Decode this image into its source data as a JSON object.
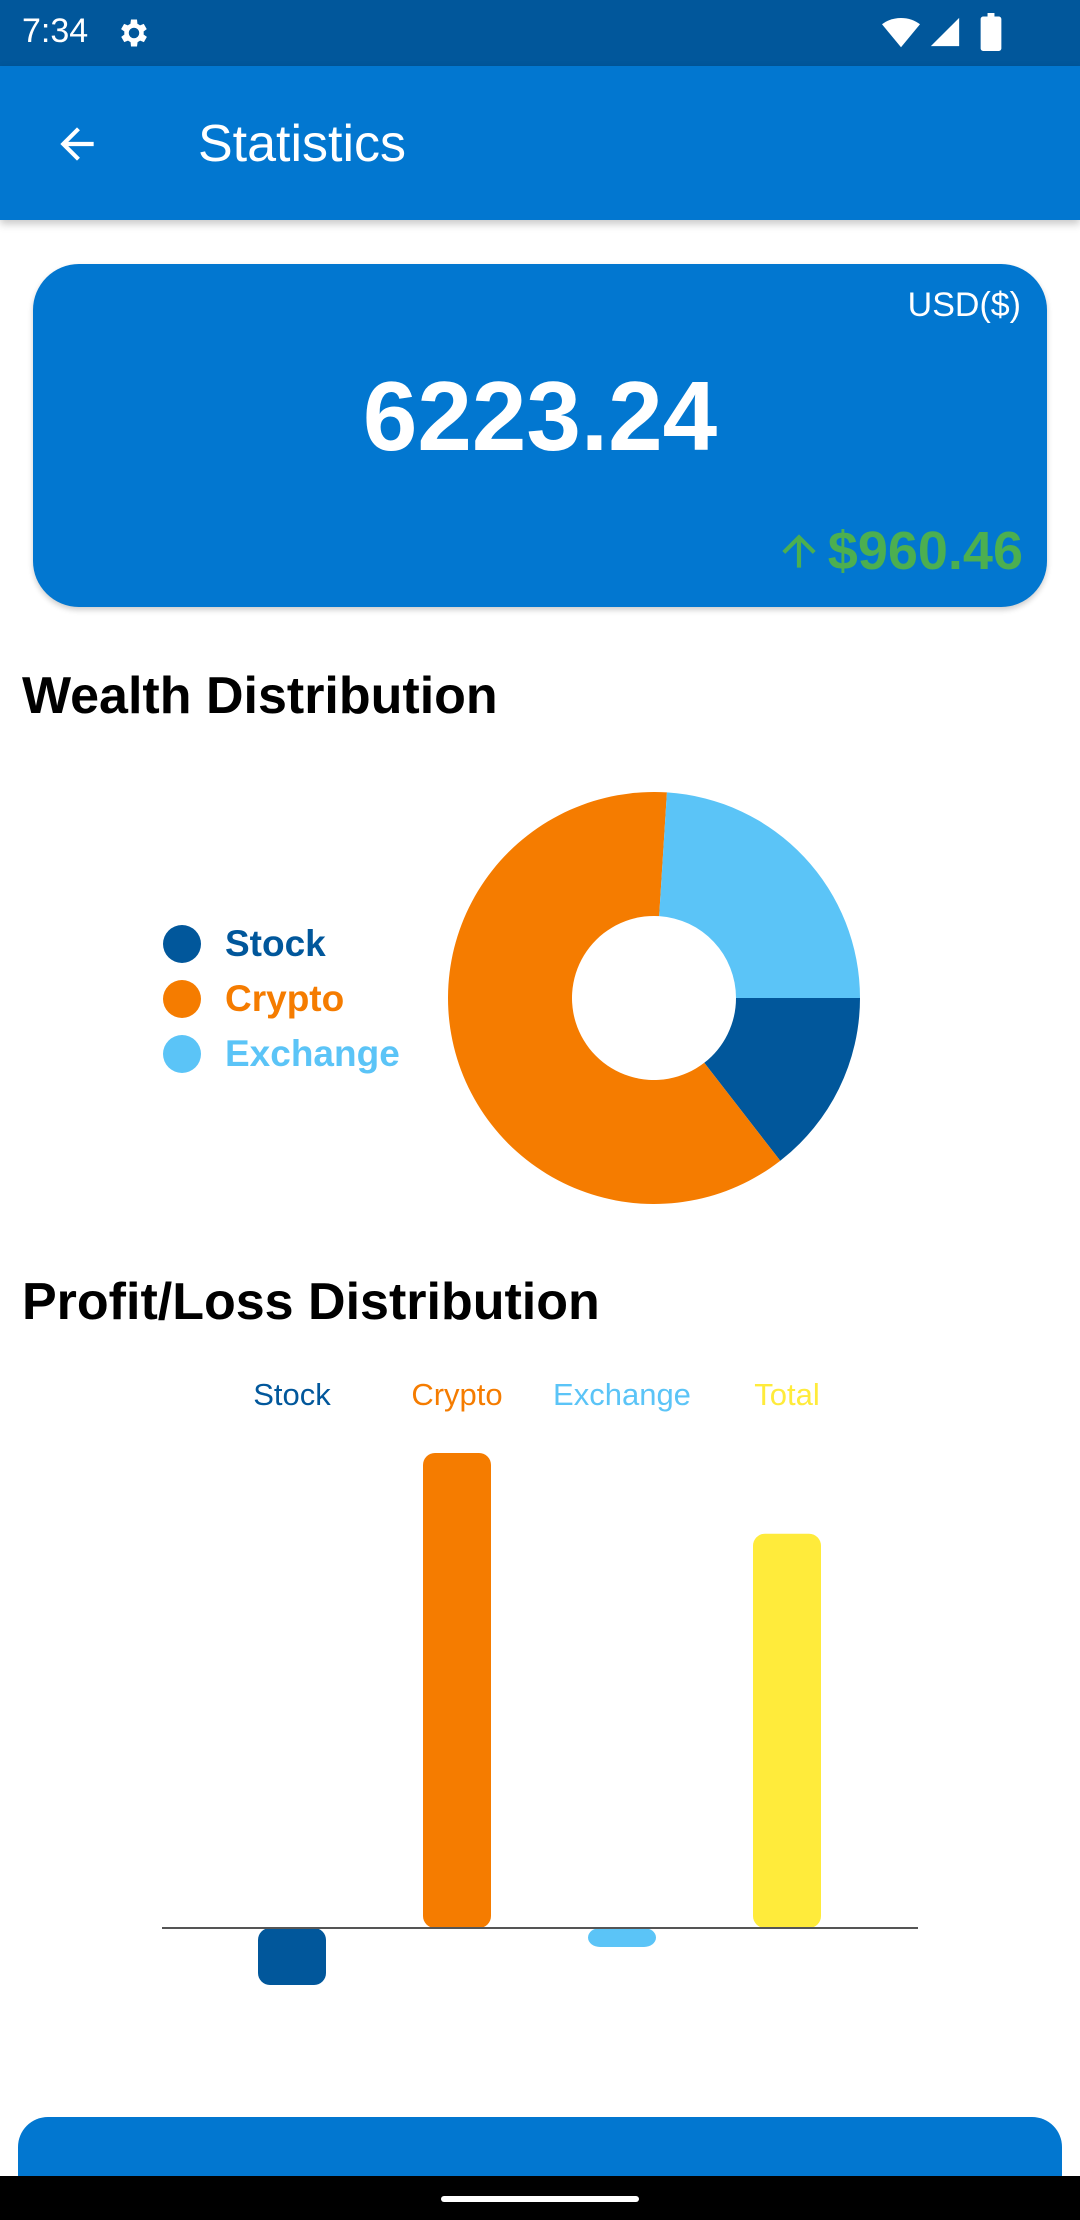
{
  "status_bar": {
    "time": "7:34",
    "icons": [
      "gear-icon",
      "wifi-icon",
      "signal-icon",
      "battery-icon"
    ]
  },
  "app_bar": {
    "title": "Statistics",
    "back_icon": "arrow-left-icon"
  },
  "balance": {
    "currency": "USD($)",
    "value": "6223.24",
    "change": "$960.46",
    "change_icon": "arrow-up-icon",
    "change_color": "#4CAF50"
  },
  "sections": {
    "wealth_title": "Wealth Distribution",
    "pl_title": "Profit/Loss Distribution"
  },
  "colors": {
    "primary": "#0277D0",
    "status_bar": "#01579B",
    "stock": "#01579B",
    "crypto": "#F57C00",
    "exchange": "#5BC4F7",
    "total": "#FFEB3B"
  },
  "chart_data": [
    {
      "type": "pie",
      "categories": [
        "Stock",
        "Crypto",
        "Exchange"
      ],
      "values": [
        14.5,
        61.5,
        24.0
      ],
      "colors": [
        "#01579B",
        "#F57C00",
        "#5BC4F7"
      ],
      "legend": "left"
    },
    {
      "type": "bar",
      "categories": [
        "Stock",
        "Crypto",
        "Exchange",
        "Total"
      ],
      "values": [
        -120,
        1000,
        -40,
        830
      ],
      "colors": [
        "#01579B",
        "#F57C00",
        "#5BC4F7",
        "#FFEB3B"
      ],
      "legend": "top",
      "grid": false,
      "ylim": [
        -300,
        1000
      ]
    }
  ]
}
